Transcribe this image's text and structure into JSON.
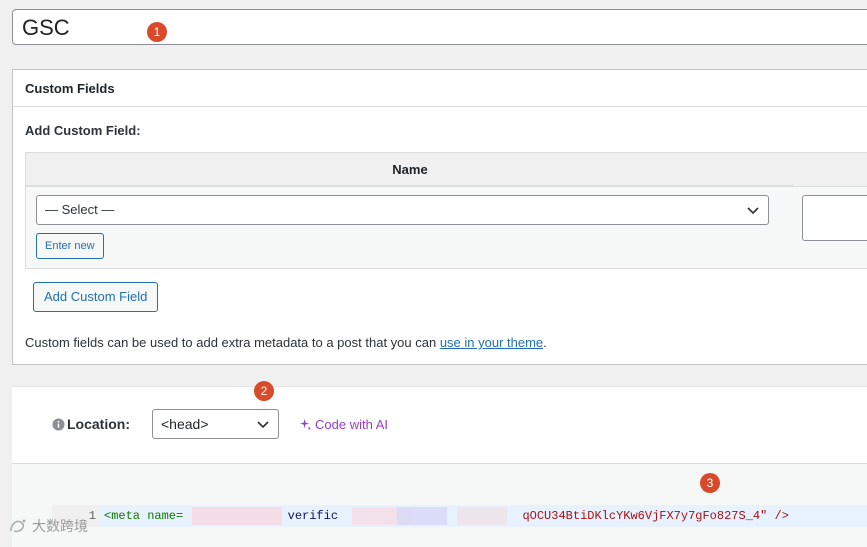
{
  "title_field": {
    "value": "GSC"
  },
  "markers": [
    "1",
    "2",
    "3"
  ],
  "custom_fields": {
    "header": "Custom Fields",
    "add_label": "Add Custom Field:",
    "column_name": "Name",
    "select_value": "— Select —",
    "enter_new_label": "Enter new",
    "add_button_label": "Add Custom Field",
    "help_text": "Custom fields can be used to add extra metadata to a post that you can ",
    "help_link": "use in your theme",
    "help_suffix": "."
  },
  "location": {
    "label": "Location:",
    "select_value": "<head>",
    "ai_label": "Code with AI"
  },
  "editor": {
    "line_number": "1",
    "code_prefix": "<meta name=",
    "code_mid": "verific",
    "code_suffix": "qOCU34BtiDKlcYKw6VjFX7y7gFo827S_4\" />"
  },
  "watermark": {
    "text": "大数跨境"
  },
  "colors": {
    "accent": "#2271b1",
    "marker": "#d94a2b",
    "ai": "#9b3bcf"
  }
}
